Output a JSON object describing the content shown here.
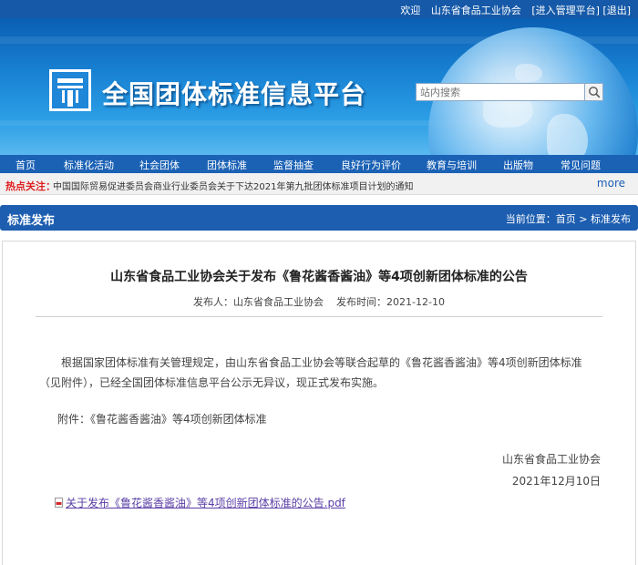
{
  "topbar": {
    "welcome": "欢迎",
    "user": "山东省食品工业协会",
    "admin_link": "[进入管理平台]",
    "logout_link": "[退出]"
  },
  "header": {
    "site_title": "全国团体标准信息平台",
    "search_placeholder": "站内搜索",
    "search_value": ""
  },
  "nav": {
    "items": [
      "首页",
      "标准化活动",
      "社会团体",
      "团体标准",
      "监督抽查",
      "良好行为评价",
      "教育与培训",
      "出版物",
      "常见问题"
    ]
  },
  "hot": {
    "label": "热点关注：",
    "text": "中国国际贸易促进委员会商业行业委员会关于下达2021年第九批团体标准项目计划的通知",
    "more": "more"
  },
  "section": {
    "title": "标准发布",
    "breadcrumb": "当前位置：首页 > 标准发布"
  },
  "article": {
    "title": "山东省食品工业协会关于发布《鲁花酱香酱油》等4项创新团体标准的公告",
    "meta": "发布人：山东省食品工业协会    发布时间：2021-12-10",
    "body": "根据国家团体标准有关管理规定，由山东省食品工业协会等联合起草的《鲁花酱香酱油》等4项创新团体标准（见附件），已经全国团体标准信息平台公示无异议，现正式发布实施。",
    "attachment": "附件：《鲁花酱香酱油》等4项创新团体标准",
    "signature": "山东省食品工业协会",
    "date": "2021年12月10日",
    "pdf_link": "关于发布《鲁花酱香酱油》等4项创新团体标准的公告.pdf"
  },
  "colors": {
    "topbar": "#1559a8",
    "nav": "#1b62b5",
    "section": "#1d5eb0",
    "hot_label": "#e02020",
    "link": "#5a3ea6"
  },
  "icons": [
    "search-icon",
    "pdf-icon",
    "site-logo"
  ]
}
